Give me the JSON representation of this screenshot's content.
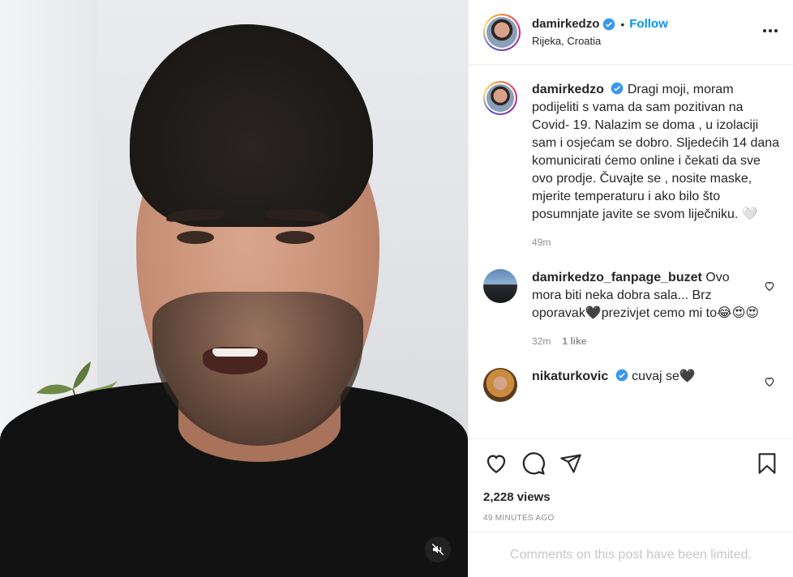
{
  "post": {
    "author": "damirkedzo",
    "follow_label": "Follow",
    "separator": "•",
    "location": "Rijeka, Croatia",
    "caption": "Dragi moji, moram podijeliti s vama da sam pozitivan na Covid- 19. Nalazim se doma , u izolaciji sam i osjećam se dobro. Sljedećih 14 dana komunicirati ćemo online i čekati da sve ovo prodje. Čuvajte se , nosite maske, mjerite temperaturu i ako bilo što posumnjate javite se svom liječniku. 🤍",
    "caption_time": "49m",
    "views": "2,228 views",
    "time_ago": "49 minutes ago",
    "comments_limited": "Comments on this post have been limited."
  },
  "comments": [
    {
      "user": "damirkedzo_fanpage_buzet",
      "text": "Ovo mora biti neka dobra sala... Brz oporavak🖤prezivjet cemo mi to😂😍😍",
      "time": "32m",
      "likes": "1 like"
    },
    {
      "user": "nikaturkovic",
      "text": "cuvaj se🖤"
    }
  ],
  "icons": {
    "verified": "verified-badge-icon",
    "more": "more-options-icon",
    "like": "heart-icon",
    "comment": "comment-icon",
    "share": "share-icon",
    "save": "bookmark-icon",
    "mute": "muted-speaker-icon"
  },
  "colors": {
    "link": "#0095f6",
    "verified": "#3897f0",
    "secondary_text": "#8e8e8e"
  }
}
